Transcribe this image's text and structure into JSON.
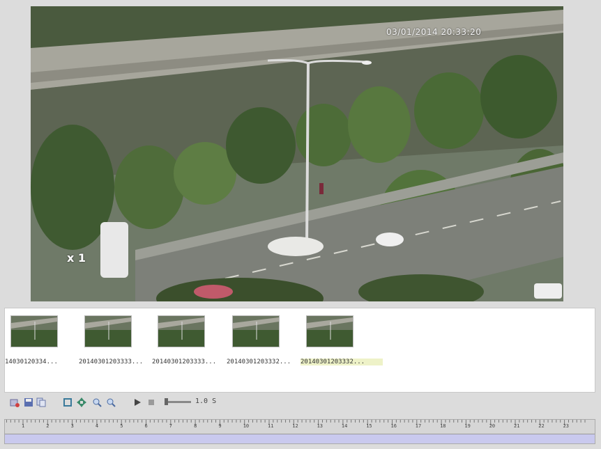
{
  "video": {
    "timestamp": "03/01/2014 20:33:20",
    "speed_overlay": "x 1"
  },
  "thumbnails": [
    {
      "caption": "14030120334...",
      "selected": false
    },
    {
      "caption": "20140301203333...",
      "selected": false
    },
    {
      "caption": "20140301203333...",
      "selected": false
    },
    {
      "caption": "20140301203332...",
      "selected": false
    },
    {
      "caption": "20140301203332...",
      "selected": true
    }
  ],
  "toolbar": {
    "speed_label": "1.0 S",
    "icons": [
      "snapshot-icon",
      "save-icon",
      "copy-icon",
      "fit-screen-icon",
      "move-icon",
      "zoom-in-icon",
      "zoom-out-icon",
      "play-icon",
      "stop-icon"
    ]
  },
  "timeline": {
    "hours": [
      "1",
      "2",
      "3",
      "4",
      "5",
      "6",
      "7",
      "8",
      "9",
      "10",
      "11",
      "12",
      "13",
      "14",
      "15",
      "16",
      "17",
      "18",
      "19",
      "20",
      "21",
      "22",
      "23"
    ]
  }
}
